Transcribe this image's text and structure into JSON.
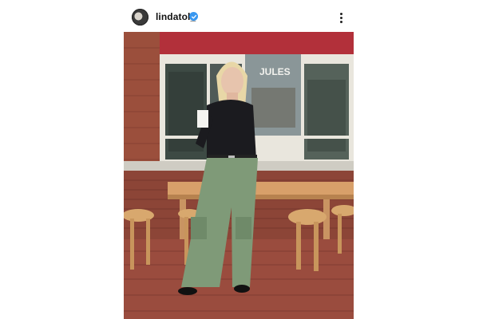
{
  "post": {
    "username": "lindatol_",
    "verified_icon": "verified-badge-icon",
    "more_icon": "more-options-icon",
    "avatar_icon": "profile-avatar"
  },
  "photo": {
    "storefront_sign": "JULES"
  },
  "colors": {
    "verified": "#3897f0",
    "brick": "#8a4a3a",
    "pants": "#7f9a78"
  }
}
